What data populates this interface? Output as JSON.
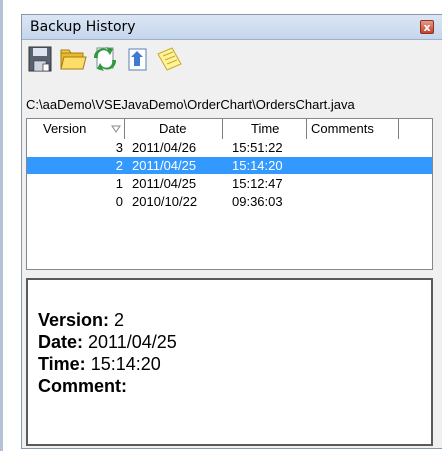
{
  "window": {
    "title": "Backup History",
    "close_label": "x"
  },
  "toolbar": {
    "buttons": [
      {
        "icon": "save-icon"
      },
      {
        "icon": "folder-icon"
      },
      {
        "icon": "refresh-icon"
      },
      {
        "icon": "restore-icon"
      },
      {
        "icon": "notes-icon"
      }
    ]
  },
  "file_path": "C:\\aaDemo\\VSEJavaDemo\\OrderChart\\OrdersChart.java",
  "list": {
    "columns": [
      "Version",
      "Date",
      "Time",
      "Comments"
    ],
    "rows": [
      {
        "version": "3",
        "date": "2011/04/26",
        "time": "15:51:22",
        "comments": "",
        "selected": false
      },
      {
        "version": "2",
        "date": "2011/04/25",
        "time": "15:14:20",
        "comments": "",
        "selected": true
      },
      {
        "version": "1",
        "date": "2011/04/25",
        "time": "15:12:47",
        "comments": "",
        "selected": false
      },
      {
        "version": "0",
        "date": "2010/10/22",
        "time": "09:36:03",
        "comments": "",
        "selected": false
      }
    ]
  },
  "details": {
    "version_label": "Version:",
    "version_value": "2",
    "date_label": "Date:",
    "date_value": "2011/04/25",
    "time_label": "Time:",
    "time_value": "15:14:20",
    "comment_label": "Comment:",
    "comment_value": ""
  },
  "colors": {
    "selection": "#3399ff",
    "titlebar": "#c5d6ec"
  }
}
